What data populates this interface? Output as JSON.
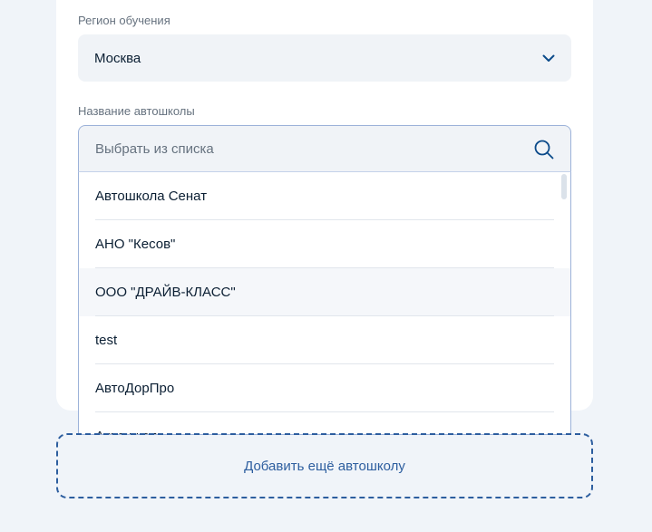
{
  "region": {
    "label": "Регион обучения",
    "value": "Москва",
    "icon": "chevron-down-icon"
  },
  "school": {
    "label": "Название автошколы",
    "placeholder": "Выбрать из списка",
    "search_icon": "search-icon",
    "options": [
      "Автошкола Сенат",
      "АНО \"Кесов\"",
      "ООО \"ДРАЙВ-КЛАСС\"",
      "test",
      "АвтоДорПро",
      "Автошкола"
    ]
  },
  "actions": {
    "add_school_label": "Добавить ещё автошколу"
  },
  "colors": {
    "accent": "#2d5e9f",
    "field_bg": "#f0f3f7",
    "page_bg": "#f0f4f9",
    "focus_border": "#9cb2d9"
  }
}
